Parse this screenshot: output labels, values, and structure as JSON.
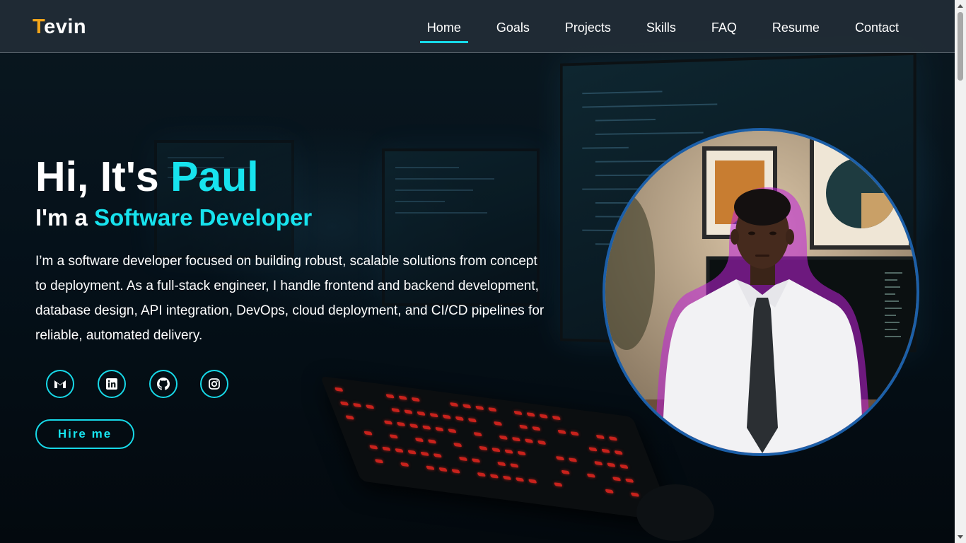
{
  "brand": {
    "logo_first_letter": "T",
    "logo_rest": "evin",
    "accent_color": "#17e3ee",
    "logo_accent_color": "#f2a51a"
  },
  "nav": {
    "items": [
      {
        "label": "Home",
        "active": true
      },
      {
        "label": "Goals",
        "active": false
      },
      {
        "label": "Projects",
        "active": false
      },
      {
        "label": "Skills",
        "active": false
      },
      {
        "label": "FAQ",
        "active": false
      },
      {
        "label": "Resume",
        "active": false
      },
      {
        "label": "Contact",
        "active": false
      }
    ]
  },
  "hero": {
    "greeting": "Hi, It's ",
    "name": "Paul",
    "role_prefix": "I'm a ",
    "role": "Software Developer",
    "description": "I’m a software developer focused on building robust, scalable solutions from concept to deployment. As a full-stack engineer, I handle frontend and backend development, database design, API integration, DevOps, cloud deployment, and CI/CD pipelines for reliable, automated delivery.",
    "hire_button": "Hire me"
  },
  "socials": [
    {
      "icon": "gmail-icon"
    },
    {
      "icon": "linkedin-icon"
    },
    {
      "icon": "github-icon"
    },
    {
      "icon": "instagram-icon"
    }
  ],
  "profile_photo": {
    "icon": "profile-photo"
  }
}
